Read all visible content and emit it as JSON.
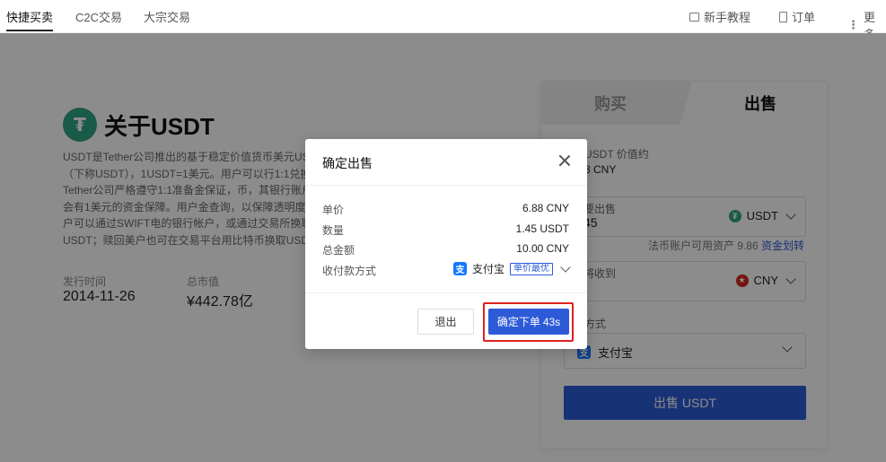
{
  "nav": {
    "tabs": [
      {
        "label": "快捷买卖"
      },
      {
        "label": "C2C交易"
      },
      {
        "label": "大宗交易"
      }
    ],
    "right": {
      "tutorial": "新手教程",
      "orders": "订单",
      "more": "更多"
    }
  },
  "about": {
    "title": "关于USDT",
    "logo_letter": "₮",
    "description": "USDT是Tether公司推出的基于稳定价值货币美元USD（下称USDT），1USDT=1美元。用户可以行1:1兑换。Tether公司严格遵守1:1准备金保证，币，其银行账户都会有1美元的资金保障。用户金查询，以保障透明度。用户可以通过SWIFT电的银行帐户，或通过交易所换取USDT；赎回美户也可在交易平台用比特币换取USDT。",
    "issue_date_label": "发行时间",
    "issue_date": "2014-11-26",
    "market_cap_label": "总市值",
    "market_cap": "¥442.78亿"
  },
  "panel": {
    "tab_buy": "购买",
    "tab_sell": "出售",
    "price_label": "USDT 价值约",
    "price_value": "3 CNY",
    "sell_label": "要出售",
    "sell_amount": "45",
    "sell_currency": "USDT",
    "available_text": "法币账户可用资产 9.86",
    "transfer_link": "资金划转",
    "receive_label": "将收到",
    "receive_currency": "CNY",
    "method_label": "方式",
    "method_value": "支付宝",
    "sell_button": "出售 USDT"
  },
  "modal": {
    "title": "确定出售",
    "rows": [
      {
        "label": "单价",
        "value": "6.88 CNY"
      },
      {
        "label": "数量",
        "value": "1.45 USDT"
      },
      {
        "label": "总金额",
        "value": "10.00 CNY"
      }
    ],
    "pay_label": "收付款方式",
    "pay_method": "支付宝",
    "pay_tag": "单价最优",
    "exit_button": "退出",
    "confirm_button": "确定下单",
    "countdown": "43s"
  },
  "colors": {
    "accent": "#2d5bd8",
    "tether": "#2fa585",
    "highlight": "#e02020"
  }
}
